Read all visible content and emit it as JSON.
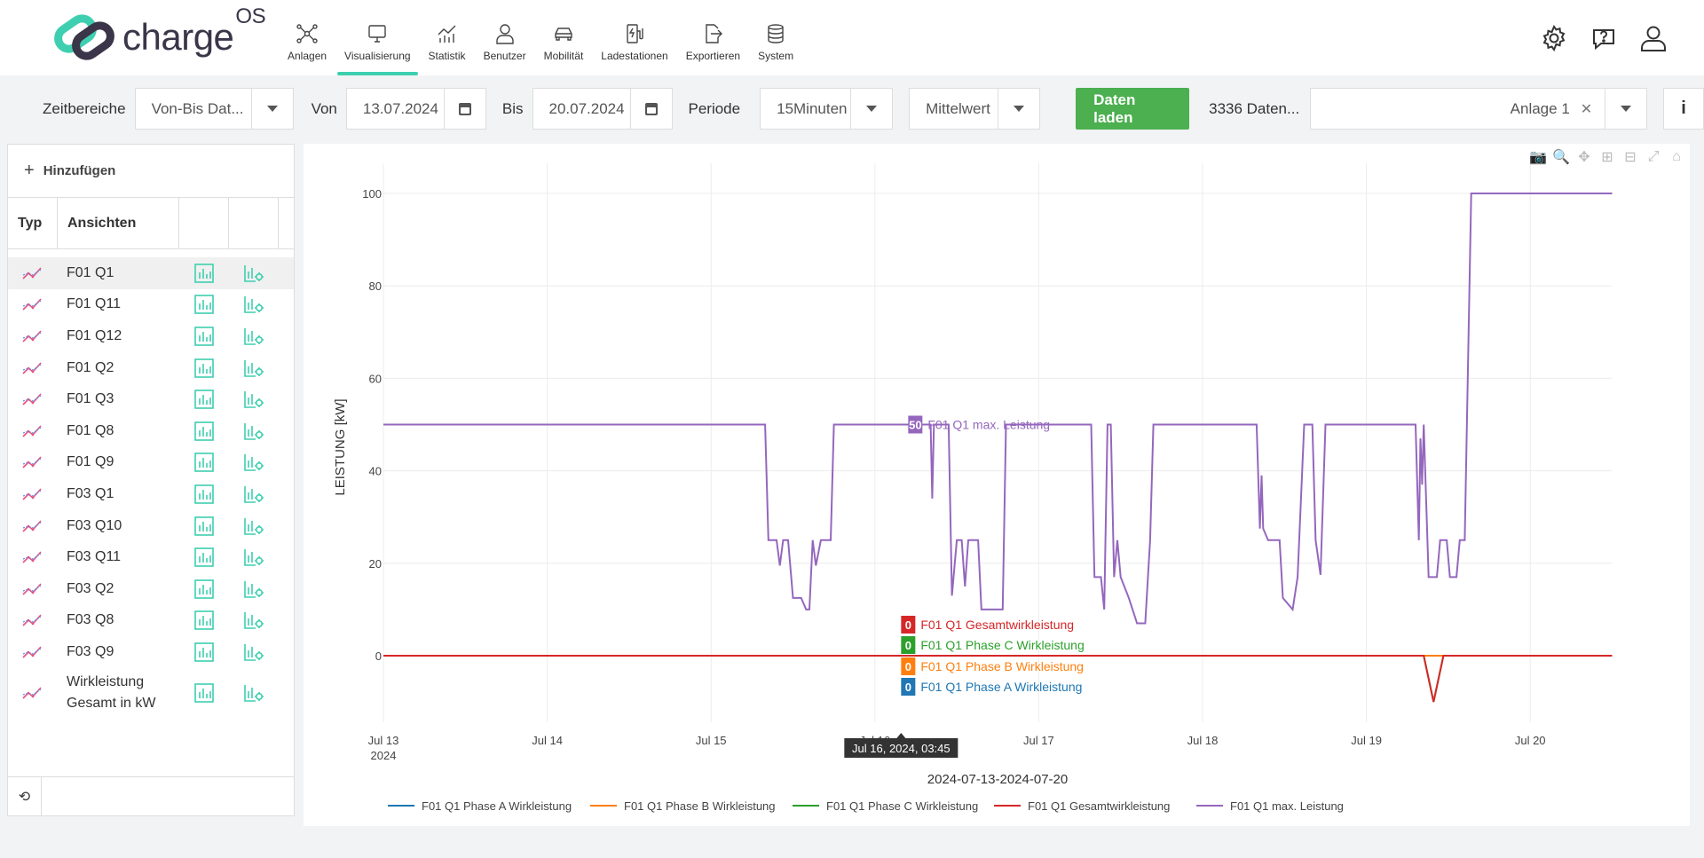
{
  "logo": {
    "text": "charge",
    "sup": "OS"
  },
  "nav": [
    {
      "label": "Anlagen",
      "icon": "network-icon"
    },
    {
      "label": "Visualisierung",
      "icon": "monitor-icon",
      "active": true
    },
    {
      "label": "Statistik",
      "icon": "chart-icon"
    },
    {
      "label": "Benutzer",
      "icon": "user-icon"
    },
    {
      "label": "Mobilität",
      "icon": "car-icon"
    },
    {
      "label": "Ladestationen",
      "icon": "charger-icon"
    },
    {
      "label": "Exportieren",
      "icon": "export-icon"
    },
    {
      "label": "System",
      "icon": "database-icon"
    }
  ],
  "toolbar": {
    "zeitbereiche_label": "Zeitbereiche",
    "zeitbereiche_value": "Von-Bis Dat...",
    "von_label": "Von",
    "von_value": "13.07.2024",
    "bis_label": "Bis",
    "bis_value": "20.07.2024",
    "periode_label": "Periode",
    "periode_value": "15Minuten",
    "aggregation_value": "Mittelwert",
    "load_button": "Daten laden",
    "count_text": "3336 Daten...",
    "anlage_value": "Anlage 1",
    "info_label": "i"
  },
  "panel": {
    "add_label": "Hinzufügen",
    "col_typ": "Typ",
    "col_ansichten": "Ansichten",
    "rows": [
      "F01 Q1",
      "F01 Q11",
      "F01 Q12",
      "F01 Q2",
      "F01 Q3",
      "F01 Q8",
      "F01 Q9",
      "F03 Q1",
      "F03 Q10",
      "F03 Q11",
      "F03 Q2",
      "F03 Q8",
      "F03 Q9",
      "Wirkleistung Gesamt in kW"
    ]
  },
  "chart_data": {
    "type": "line",
    "title": "",
    "xlabel": "2024-07-13-2024-07-20",
    "ylabel": "LEISTUNG [kW]",
    "ylim": [
      -12,
      106
    ],
    "yticks": [
      0,
      20,
      40,
      60,
      80,
      100
    ],
    "xticks": [
      "Jul 13\n2024",
      "Jul 14",
      "Jul 15",
      "Jul 16",
      "Jul 17",
      "Jul 18",
      "Jul 19",
      "Jul 20"
    ],
    "xlim_days": [
      0,
      7.5
    ],
    "grid": true,
    "legend_position": "bottom",
    "hover_label": "Jul 16, 2024, 03:45",
    "hover_x_day": 3.16,
    "series": [
      {
        "name": "F01 Q1 Phase A Wirkleistung",
        "color": "#1f77b4",
        "hover_value": "0",
        "points": [
          [
            0,
            0
          ],
          [
            7.5,
            0
          ]
        ]
      },
      {
        "name": "F01 Q1 Phase B Wirkleistung",
        "color": "#ff7f0e",
        "hover_value": "0",
        "points": [
          [
            0,
            0
          ],
          [
            7.5,
            0
          ]
        ]
      },
      {
        "name": "F01 Q1 Phase C Wirkleistung",
        "color": "#2ca02c",
        "hover_value": "0",
        "points": [
          [
            0,
            0
          ],
          [
            6.35,
            0
          ],
          [
            6.41,
            -10
          ],
          [
            6.47,
            0
          ],
          [
            7.5,
            0
          ]
        ]
      },
      {
        "name": "F01 Q1 Gesamtwirkleistung",
        "color": "#d62728",
        "hover_value": "0",
        "points": [
          [
            0,
            0
          ],
          [
            6.35,
            0
          ],
          [
            6.41,
            -10
          ],
          [
            6.47,
            0
          ],
          [
            7.5,
            0
          ]
        ]
      },
      {
        "name": "F01 Q1 max. Leistung",
        "color": "#9467bd",
        "hover_value": "50",
        "points": [
          [
            0,
            50
          ],
          [
            2.33,
            50
          ],
          [
            2.35,
            25
          ],
          [
            2.4,
            25
          ],
          [
            2.42,
            19.5
          ],
          [
            2.44,
            25
          ],
          [
            2.47,
            25
          ],
          [
            2.5,
            12.5
          ],
          [
            2.55,
            12.5
          ],
          [
            2.58,
            10
          ],
          [
            2.6,
            10
          ],
          [
            2.62,
            25
          ],
          [
            2.64,
            19.5
          ],
          [
            2.67,
            25
          ],
          [
            2.73,
            25
          ],
          [
            2.75,
            50
          ],
          [
            3.34,
            50
          ],
          [
            3.35,
            34
          ],
          [
            3.36,
            50
          ],
          [
            3.45,
            50
          ],
          [
            3.47,
            13
          ],
          [
            3.5,
            25
          ],
          [
            3.53,
            25
          ],
          [
            3.55,
            15
          ],
          [
            3.57,
            25
          ],
          [
            3.63,
            25
          ],
          [
            3.65,
            10
          ],
          [
            3.78,
            10
          ],
          [
            3.8,
            50
          ],
          [
            4.32,
            50
          ],
          [
            4.34,
            17
          ],
          [
            4.38,
            17
          ],
          [
            4.4,
            10
          ],
          [
            4.42,
            50
          ],
          [
            4.44,
            50
          ],
          [
            4.46,
            17
          ],
          [
            4.48,
            25
          ],
          [
            4.5,
            17
          ],
          [
            4.55,
            12.5
          ],
          [
            4.6,
            7
          ],
          [
            4.65,
            7
          ],
          [
            4.68,
            25
          ],
          [
            4.7,
            50
          ],
          [
            5.33,
            50
          ],
          [
            5.35,
            27.5
          ],
          [
            5.36,
            39
          ],
          [
            5.37,
            27.5
          ],
          [
            5.4,
            25
          ],
          [
            5.47,
            25
          ],
          [
            5.49,
            12.5
          ],
          [
            5.55,
            10
          ],
          [
            5.58,
            17
          ],
          [
            5.62,
            50
          ],
          [
            5.67,
            50
          ],
          [
            5.69,
            25
          ],
          [
            5.72,
            17.5
          ],
          [
            5.75,
            50
          ],
          [
            6.3,
            50
          ],
          [
            6.32,
            25
          ],
          [
            6.33,
            47
          ],
          [
            6.34,
            37
          ],
          [
            6.35,
            50
          ],
          [
            6.38,
            17
          ],
          [
            6.43,
            17
          ],
          [
            6.45,
            25
          ],
          [
            6.49,
            25
          ],
          [
            6.51,
            17
          ],
          [
            6.55,
            17
          ],
          [
            6.57,
            25
          ],
          [
            6.6,
            25
          ],
          [
            6.64,
            100
          ],
          [
            7.5,
            100
          ]
        ]
      }
    ]
  },
  "colors": {
    "accent": "#3ecfb0",
    "brand_dark": "#3b3549",
    "primary_button": "#4caf50"
  }
}
